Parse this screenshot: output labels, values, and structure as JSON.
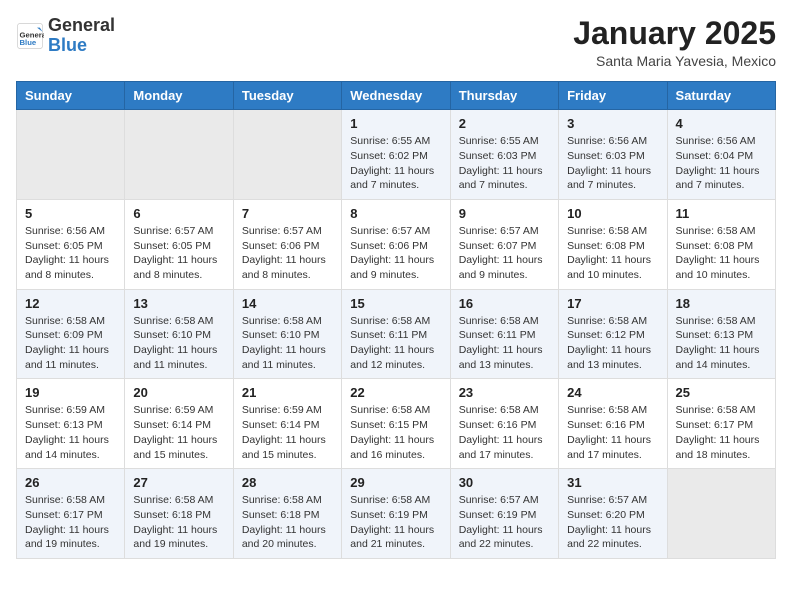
{
  "header": {
    "logo_line1": "General",
    "logo_line2": "Blue",
    "month_title": "January 2025",
    "subtitle": "Santa Maria Yavesia, Mexico"
  },
  "days_of_week": [
    "Sunday",
    "Monday",
    "Tuesday",
    "Wednesday",
    "Thursday",
    "Friday",
    "Saturday"
  ],
  "weeks": [
    [
      {
        "num": "",
        "info": ""
      },
      {
        "num": "",
        "info": ""
      },
      {
        "num": "",
        "info": ""
      },
      {
        "num": "1",
        "info": "Sunrise: 6:55 AM\nSunset: 6:02 PM\nDaylight: 11 hours and 7 minutes."
      },
      {
        "num": "2",
        "info": "Sunrise: 6:55 AM\nSunset: 6:03 PM\nDaylight: 11 hours and 7 minutes."
      },
      {
        "num": "3",
        "info": "Sunrise: 6:56 AM\nSunset: 6:03 PM\nDaylight: 11 hours and 7 minutes."
      },
      {
        "num": "4",
        "info": "Sunrise: 6:56 AM\nSunset: 6:04 PM\nDaylight: 11 hours and 7 minutes."
      }
    ],
    [
      {
        "num": "5",
        "info": "Sunrise: 6:56 AM\nSunset: 6:05 PM\nDaylight: 11 hours and 8 minutes."
      },
      {
        "num": "6",
        "info": "Sunrise: 6:57 AM\nSunset: 6:05 PM\nDaylight: 11 hours and 8 minutes."
      },
      {
        "num": "7",
        "info": "Sunrise: 6:57 AM\nSunset: 6:06 PM\nDaylight: 11 hours and 8 minutes."
      },
      {
        "num": "8",
        "info": "Sunrise: 6:57 AM\nSunset: 6:06 PM\nDaylight: 11 hours and 9 minutes."
      },
      {
        "num": "9",
        "info": "Sunrise: 6:57 AM\nSunset: 6:07 PM\nDaylight: 11 hours and 9 minutes."
      },
      {
        "num": "10",
        "info": "Sunrise: 6:58 AM\nSunset: 6:08 PM\nDaylight: 11 hours and 10 minutes."
      },
      {
        "num": "11",
        "info": "Sunrise: 6:58 AM\nSunset: 6:08 PM\nDaylight: 11 hours and 10 minutes."
      }
    ],
    [
      {
        "num": "12",
        "info": "Sunrise: 6:58 AM\nSunset: 6:09 PM\nDaylight: 11 hours and 11 minutes."
      },
      {
        "num": "13",
        "info": "Sunrise: 6:58 AM\nSunset: 6:10 PM\nDaylight: 11 hours and 11 minutes."
      },
      {
        "num": "14",
        "info": "Sunrise: 6:58 AM\nSunset: 6:10 PM\nDaylight: 11 hours and 11 minutes."
      },
      {
        "num": "15",
        "info": "Sunrise: 6:58 AM\nSunset: 6:11 PM\nDaylight: 11 hours and 12 minutes."
      },
      {
        "num": "16",
        "info": "Sunrise: 6:58 AM\nSunset: 6:11 PM\nDaylight: 11 hours and 13 minutes."
      },
      {
        "num": "17",
        "info": "Sunrise: 6:58 AM\nSunset: 6:12 PM\nDaylight: 11 hours and 13 minutes."
      },
      {
        "num": "18",
        "info": "Sunrise: 6:58 AM\nSunset: 6:13 PM\nDaylight: 11 hours and 14 minutes."
      }
    ],
    [
      {
        "num": "19",
        "info": "Sunrise: 6:59 AM\nSunset: 6:13 PM\nDaylight: 11 hours and 14 minutes."
      },
      {
        "num": "20",
        "info": "Sunrise: 6:59 AM\nSunset: 6:14 PM\nDaylight: 11 hours and 15 minutes."
      },
      {
        "num": "21",
        "info": "Sunrise: 6:59 AM\nSunset: 6:14 PM\nDaylight: 11 hours and 15 minutes."
      },
      {
        "num": "22",
        "info": "Sunrise: 6:58 AM\nSunset: 6:15 PM\nDaylight: 11 hours and 16 minutes."
      },
      {
        "num": "23",
        "info": "Sunrise: 6:58 AM\nSunset: 6:16 PM\nDaylight: 11 hours and 17 minutes."
      },
      {
        "num": "24",
        "info": "Sunrise: 6:58 AM\nSunset: 6:16 PM\nDaylight: 11 hours and 17 minutes."
      },
      {
        "num": "25",
        "info": "Sunrise: 6:58 AM\nSunset: 6:17 PM\nDaylight: 11 hours and 18 minutes."
      }
    ],
    [
      {
        "num": "26",
        "info": "Sunrise: 6:58 AM\nSunset: 6:17 PM\nDaylight: 11 hours and 19 minutes."
      },
      {
        "num": "27",
        "info": "Sunrise: 6:58 AM\nSunset: 6:18 PM\nDaylight: 11 hours and 19 minutes."
      },
      {
        "num": "28",
        "info": "Sunrise: 6:58 AM\nSunset: 6:18 PM\nDaylight: 11 hours and 20 minutes."
      },
      {
        "num": "29",
        "info": "Sunrise: 6:58 AM\nSunset: 6:19 PM\nDaylight: 11 hours and 21 minutes."
      },
      {
        "num": "30",
        "info": "Sunrise: 6:57 AM\nSunset: 6:19 PM\nDaylight: 11 hours and 22 minutes."
      },
      {
        "num": "31",
        "info": "Sunrise: 6:57 AM\nSunset: 6:20 PM\nDaylight: 11 hours and 22 minutes."
      },
      {
        "num": "",
        "info": ""
      }
    ]
  ]
}
